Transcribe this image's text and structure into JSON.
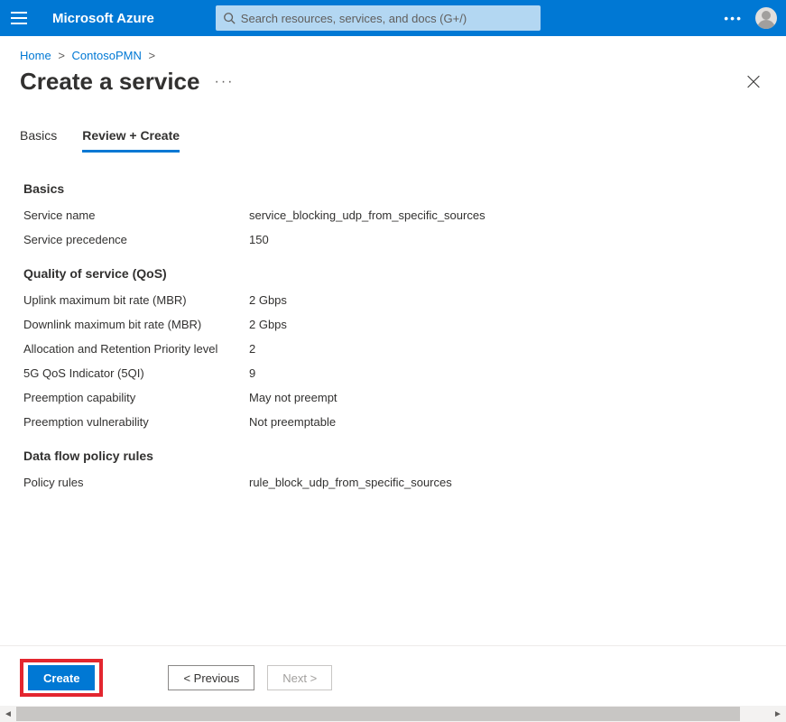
{
  "header": {
    "brand": "Microsoft Azure",
    "search_placeholder": "Search resources, services, and docs (G+/)"
  },
  "breadcrumb": {
    "items": [
      "Home",
      "ContosoPMN"
    ]
  },
  "page": {
    "title": "Create a service"
  },
  "tabs": {
    "basics": "Basics",
    "review": "Review + Create"
  },
  "sections": {
    "basics": {
      "heading": "Basics",
      "rows": {
        "service_name": {
          "k": "Service name",
          "v": "service_blocking_udp_from_specific_sources"
        },
        "precedence": {
          "k": "Service precedence",
          "v": "150"
        }
      }
    },
    "qos": {
      "heading": "Quality of service (QoS)",
      "rows": {
        "uplink": {
          "k": "Uplink maximum bit rate (MBR)",
          "v": "2 Gbps"
        },
        "downlink": {
          "k": "Downlink maximum bit rate (MBR)",
          "v": "2 Gbps"
        },
        "arp": {
          "k": "Allocation and Retention Priority level",
          "v": "2"
        },
        "fiveqi": {
          "k": "5G QoS Indicator (5QI)",
          "v": "9"
        },
        "preempt_cap": {
          "k": "Preemption capability",
          "v": "May not preempt"
        },
        "preempt_vul": {
          "k": "Preemption vulnerability",
          "v": "Not preemptable"
        }
      }
    },
    "rules": {
      "heading": "Data flow policy rules",
      "rows": {
        "policy": {
          "k": "Policy rules",
          "v": "rule_block_udp_from_specific_sources"
        }
      }
    }
  },
  "footer": {
    "create": "Create",
    "previous": "< Previous",
    "next": "Next >"
  }
}
